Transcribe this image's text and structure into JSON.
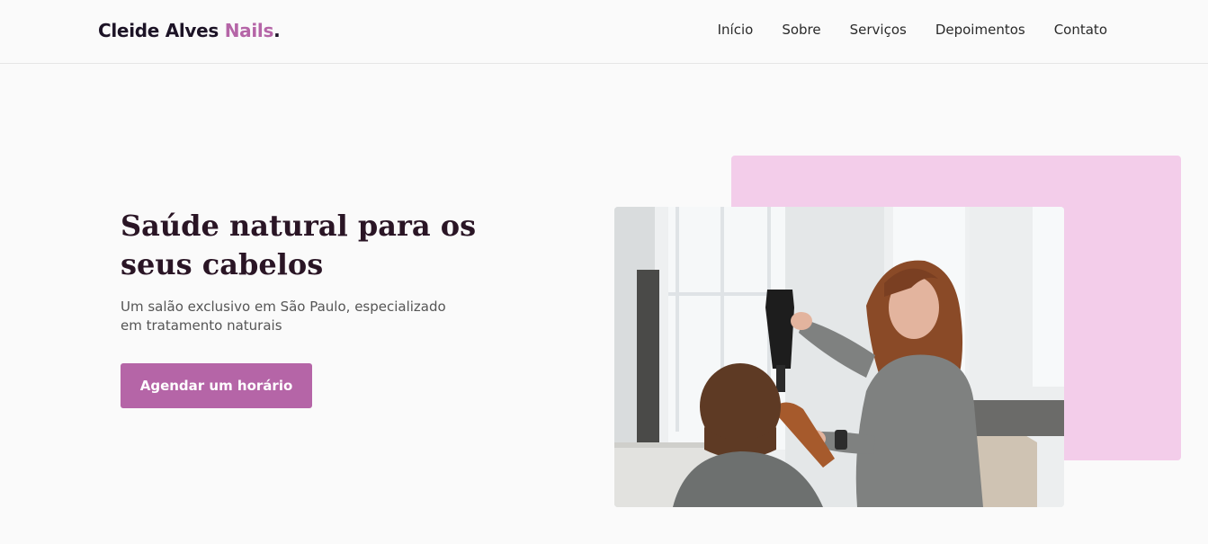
{
  "header": {
    "logo_main": "Cleide Alves ",
    "logo_accent": "Nails",
    "logo_dot": ".",
    "nav": [
      {
        "label": "Início"
      },
      {
        "label": "Sobre"
      },
      {
        "label": "Serviços"
      },
      {
        "label": "Depoimentos"
      },
      {
        "label": "Contato"
      }
    ]
  },
  "hero": {
    "title": "Saúde natural para os seus cabelos",
    "subtitle": "Um salão exclusivo em São Paulo, especializado em tratamento naturais",
    "cta_label": "Agendar um horário"
  },
  "colors": {
    "accent": "#b565a7",
    "pink_block": "#f3cdea",
    "heading": "#2a1525"
  },
  "image": {
    "subject": "hairdresser-blow-drying-client-photo"
  }
}
